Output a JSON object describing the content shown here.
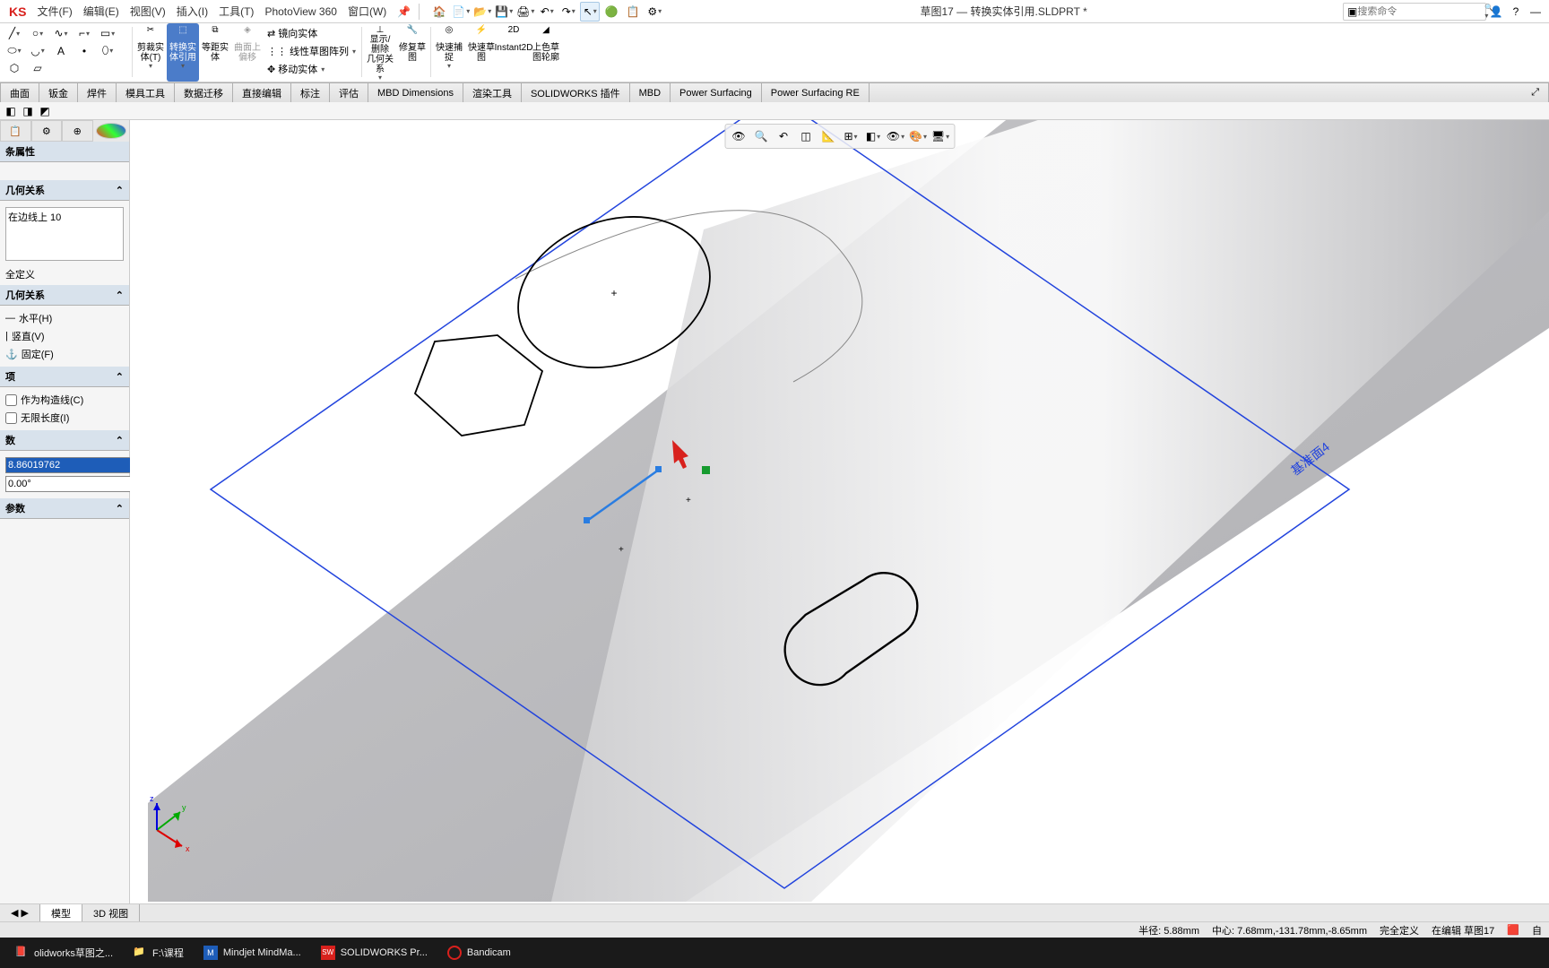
{
  "menubar": {
    "logo": "KS",
    "items": [
      "文件(F)",
      "编辑(E)",
      "视图(V)",
      "插入(I)",
      "工具(T)",
      "PhotoView 360",
      "窗口(W)"
    ],
    "doc_title": "草图17 — 转换实体引用.SLDPRT *",
    "search_placeholder": "搜索命令"
  },
  "ribbon": {
    "big_buttons": [
      {
        "label": "剪裁实\n体(T)",
        "active": false
      },
      {
        "label": "转换实\n体引用",
        "active": true
      },
      {
        "label": "等距实\n体",
        "active": false
      },
      {
        "label": "曲面上\n偏移",
        "active": false
      }
    ],
    "small_buttons": [
      "镜向实体",
      "线性草图阵列",
      "移动实体"
    ],
    "right_big": [
      "显示/删除\n几何关系",
      "修复草\n图",
      "快速捕\n捉",
      "快速草\n图",
      "Instant2D",
      "上色草\n图轮廓"
    ]
  },
  "tabs": [
    "曲面",
    "钣金",
    "焊件",
    "模具工具",
    "数据迁移",
    "直接编辑",
    "标注",
    "评估",
    "MBD Dimensions",
    "渲染工具",
    "SOLIDWORKS 插件",
    "MBD",
    "Power Surfacing",
    "Power Surfacing RE"
  ],
  "panel": {
    "title": "条属性",
    "sections": {
      "rel_title": "几何关系",
      "rel_item": "在边线上 10",
      "status": "全定义",
      "add_rel_title": "几何关系",
      "add_relations": [
        "水平(H)",
        "竖直(V)",
        "固定(F)"
      ],
      "opts_title": "项",
      "opt1": "作为构造线(C)",
      "opt2": "无限长度(I)",
      "params_title": "数",
      "param1": "8.86019762",
      "param2": "0.00°",
      "more_title": "参数"
    }
  },
  "viewport": {
    "plane_label": "基准面4"
  },
  "bottom_tabs": [
    "模型",
    "3D 视图"
  ],
  "status": {
    "radius": "半径: 5.88mm",
    "center": "中心: 7.68mm,-131.78mm,-8.65mm",
    "defstate": "完全定义",
    "editing": "在编辑 草图17",
    "suffix": "自"
  },
  "taskbar": {
    "items": [
      {
        "label": "olidworks草图之..."
      },
      {
        "label": "F:\\课程"
      },
      {
        "label": "Mindjet MindMa..."
      },
      {
        "label": "SOLIDWORKS Pr..."
      },
      {
        "label": "Bandicam"
      }
    ]
  }
}
